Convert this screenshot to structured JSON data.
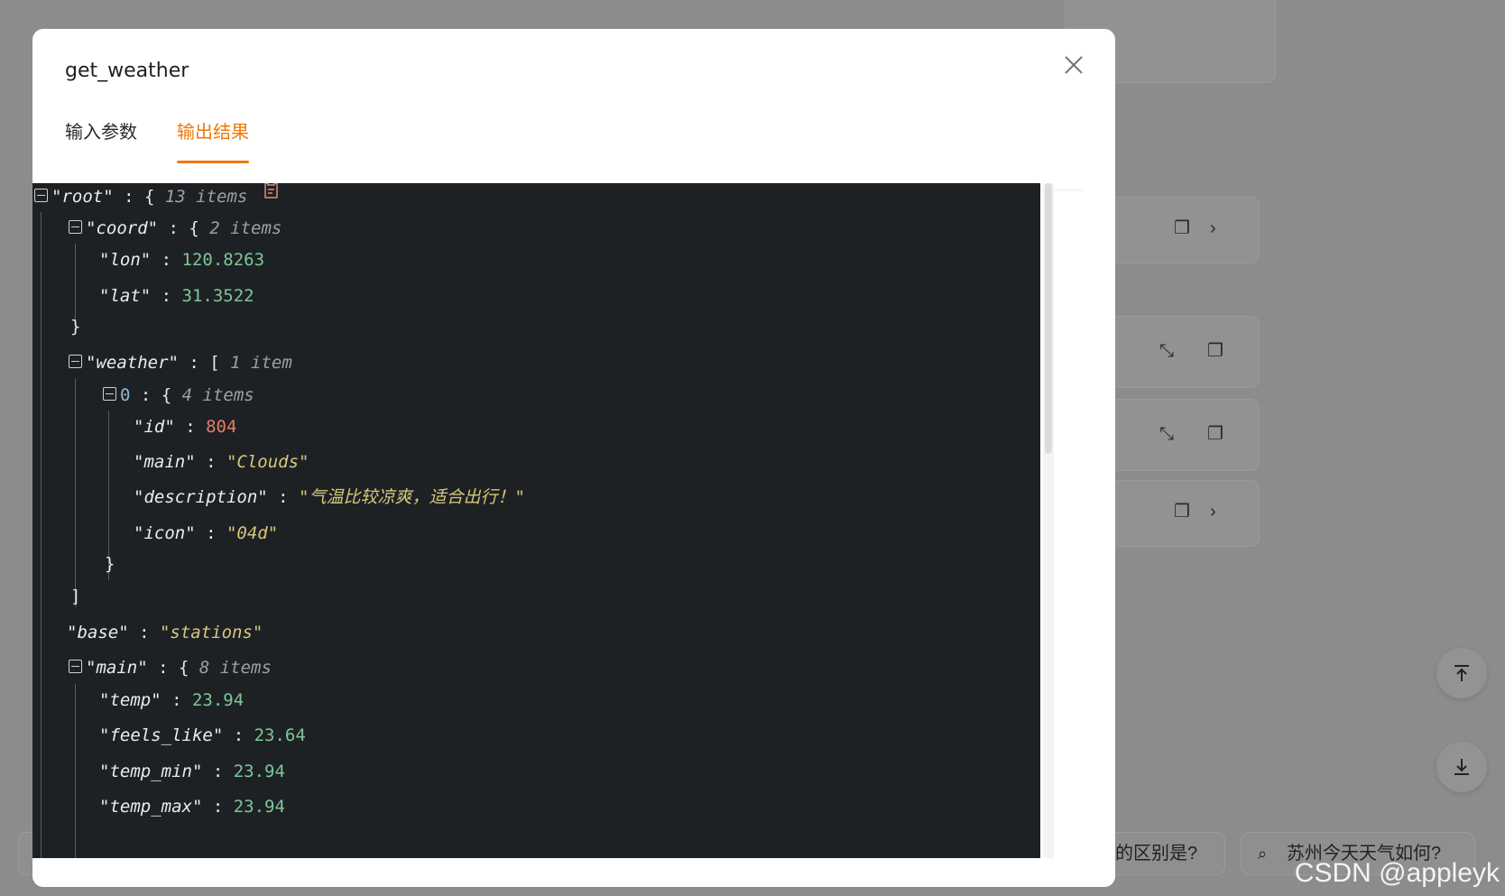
{
  "background": {
    "chip_left_text": "的区别是?",
    "chip_right_text": "苏州今天天气如何?",
    "watermark": "CSDN @appleyk"
  },
  "modal": {
    "title": "get_weather",
    "tabs": [
      {
        "label": "输入参数",
        "active": false
      },
      {
        "label": "输出结果",
        "active": true
      }
    ]
  },
  "json_tree": {
    "root_key": "\"root\"",
    "root_count": "13 items",
    "coord_key": "\"coord\"",
    "coord_count": "2 items",
    "lon_key": "\"lon\"",
    "lon_val": "120.8263",
    "lat_key": "\"lat\"",
    "lat_val": "31.3522",
    "weather_key": "\"weather\"",
    "weather_count": "1 item",
    "w0_index": "0",
    "w0_count": "4 items",
    "id_key": "\"id\"",
    "id_val": "804",
    "main_key": "\"main\"",
    "main_val": "\"Clouds\"",
    "desc_key": "\"description\"",
    "desc_val": "\"气温比较凉爽，适合出行！\"",
    "icon_key": "\"icon\"",
    "icon_val": "\"04d\"",
    "base_key": "\"base\"",
    "base_val": "\"stations\"",
    "mainobj_key": "\"main\"",
    "mainobj_count": "8 items",
    "temp_key": "\"temp\"",
    "temp_val": "23.94",
    "feels_key": "\"feels_like\"",
    "feels_val": "23.64",
    "tmin_key": "\"temp_min\"",
    "tmin_val": "23.94",
    "tmax_key": "\"temp_max\"",
    "tmax_val": "23.94"
  },
  "colors": {
    "accent": "#f0780a",
    "panel_bg": "#1e2124",
    "number": "#7ec699",
    "string": "#d7c77b"
  }
}
